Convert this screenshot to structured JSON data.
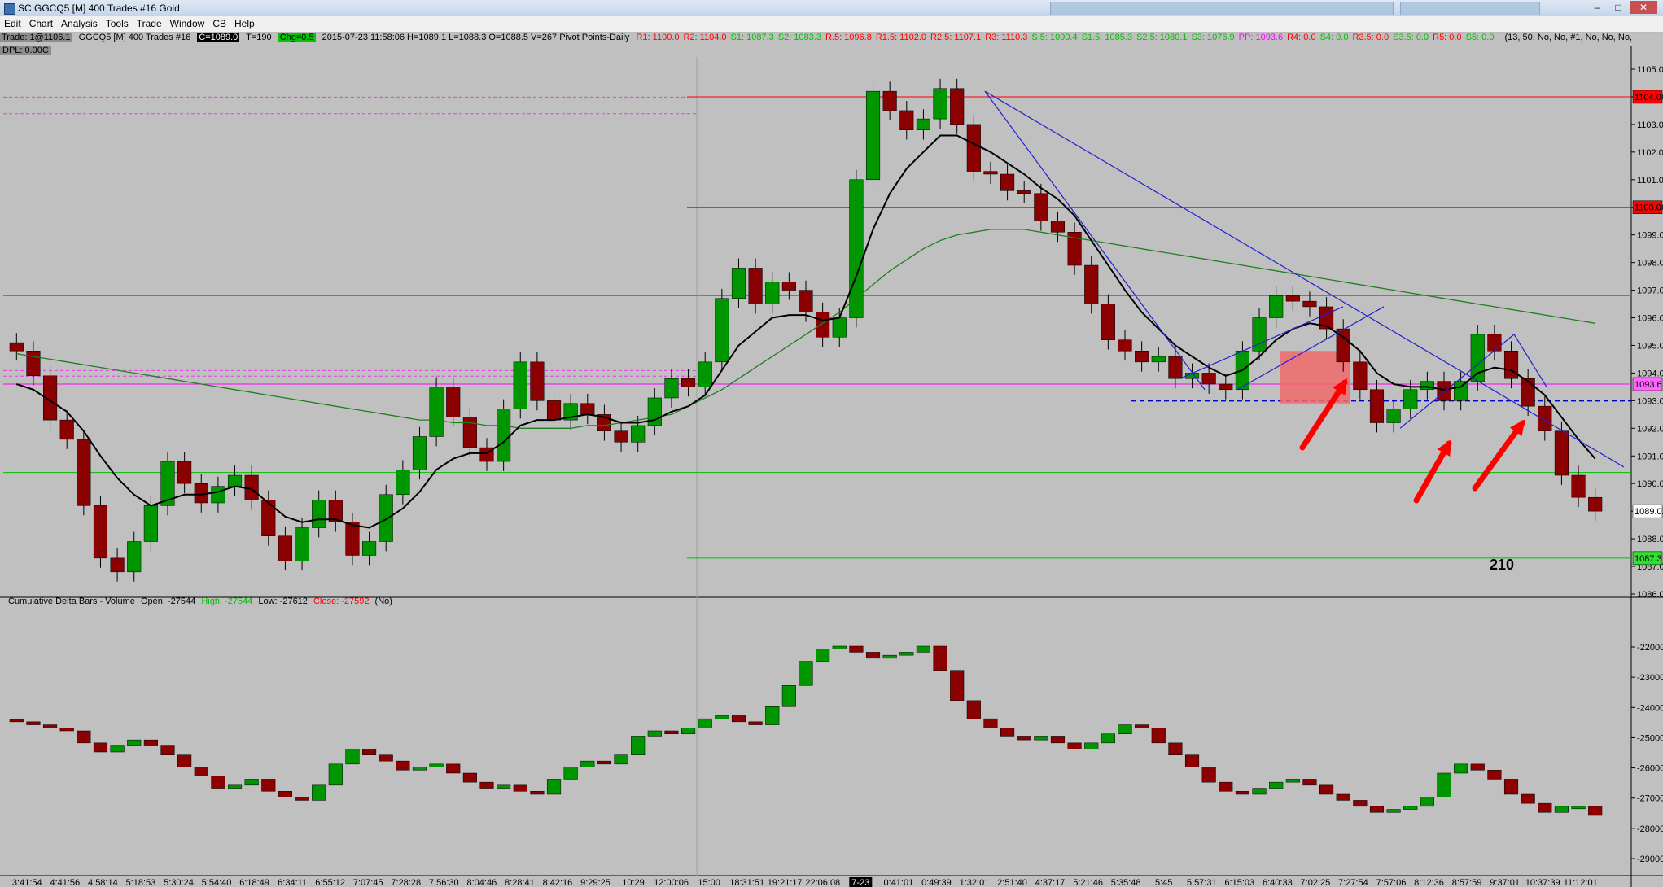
{
  "window": {
    "title": "SC GGCQ5 [M]  400 Trades  #16  Gold",
    "controls": [
      "–",
      "□",
      "✕"
    ]
  },
  "menu": [
    "Edit",
    "Chart",
    "Analysis",
    "Tools",
    "Trade",
    "Window",
    "CB",
    "Help"
  ],
  "status": {
    "trade": "Trade: 1@1106.1",
    "symbol": "GGCQ5 [M]  400 Trades  #16",
    "close": "C=1089.0",
    "ticks": "T=190",
    "change": "Chg=0.5",
    "ohlc": "2015-07-23 11:58:06 H=1089.1 L=1088.3 O=1088.5 V=267 Pivot Points-Daily",
    "pivots": [
      {
        "text": "R1: 1100.0",
        "color": "#ff0000"
      },
      {
        "text": "R2: 1104.0",
        "color": "#ff0000"
      },
      {
        "text": "S1: 1087.3",
        "color": "#00c000"
      },
      {
        "text": "S2: 1083.3",
        "color": "#00c000"
      },
      {
        "text": "R.5: 1096.8",
        "color": "#ff0000"
      },
      {
        "text": "R1.5: 1102.0",
        "color": "#ff0000"
      },
      {
        "text": "R2.5: 1107.1",
        "color": "#ff0000"
      },
      {
        "text": "R3: 1110.3",
        "color": "#ff0000"
      },
      {
        "text": "S.5: 1090.4",
        "color": "#00c000"
      },
      {
        "text": "S1.5: 1085.3",
        "color": "#00c000"
      },
      {
        "text": "S2.5: 1080.1",
        "color": "#00c000"
      },
      {
        "text": "S3: 1076.9",
        "color": "#00c000"
      },
      {
        "text": "PP: 1093.6",
        "color": "#ff00ff"
      },
      {
        "text": "R4: 0.0",
        "color": "#ff0000"
      },
      {
        "text": "S4: 0.0",
        "color": "#00c000"
      },
      {
        "text": "R3.5: 0.0",
        "color": "#ff0000"
      },
      {
        "text": "S3.5: 0.0",
        "color": "#00c000"
      },
      {
        "text": "R5: 0.0",
        "color": "#ff0000"
      },
      {
        "text": "S5: 0.0",
        "color": "#00c000"
      }
    ],
    "params": "(13, 50, No, No, #1, No, No, No,",
    "dpl": "DPL: 0.00C"
  },
  "lower_title": {
    "name": "Cumulative Delta Bars - Volume",
    "open": "Open: -27544",
    "high": "High: -27544",
    "low": "Low: -27612",
    "close": "Close: -27592",
    "flag": "(No)"
  },
  "annotation": "210",
  "colors": {
    "up": "#009600",
    "down": "#8b0000",
    "ma_fast": "#000000",
    "ma_slow": "#208020",
    "trend": "#2020d0",
    "arrow": "#ff0000",
    "zone": "#f06a6a",
    "resistance": "#ff0000",
    "support": "#00c000",
    "pivot": "#ff00ff"
  },
  "chart_data": [
    {
      "type": "line",
      "title": "",
      "x_ticks": [
        "3:41:54",
        "4:41:56",
        "4:58:14",
        "5:18:53",
        "5:30:24",
        "5:54:40",
        "6:18:49",
        "6:34:11",
        "6:55:12",
        "7:07:45",
        "7:28:28",
        "7:56:30",
        "8:04:46",
        "8:28:41",
        "8:42:16",
        "9:29:25",
        "10:29",
        "12:00:06",
        "15:00",
        "18:31:51",
        "19:21:17",
        "22:06:08",
        "7-23",
        "0:41:01",
        "0:49:39",
        "1:32:01",
        "2:51:40",
        "4:37:17",
        "5:21:46",
        "5:35:48",
        "5:45",
        "5:57:31",
        "6:15:03",
        "6:40:33",
        "7:02:25",
        "7:27:54",
        "7:57:06",
        "8:12:36",
        "8:57:59",
        "9:37:01",
        "10:37:39",
        "11:12:01"
      ],
      "y_ticks": [
        "1105.0",
        "1104.0",
        "1103.0",
        "1102.0",
        "1101.0",
        "1100.0",
        "1099.0",
        "1098.0",
        "1097.0",
        "1096.0",
        "1095.0",
        "1094.0",
        "1093.0",
        "1092.0",
        "1091.0",
        "1090.0",
        "1089.0",
        "1088.0",
        "1087.0",
        "1086.0"
      ],
      "ylim": [
        1086,
        1105.6
      ],
      "price_markers": [
        "1104.0",
        "1100.0",
        "1093.6",
        "1089.0",
        "1087.3"
      ],
      "close": [
        1094.8,
        1093.9,
        1092.3,
        1091.6,
        1089.2,
        1087.3,
        1086.8,
        1087.9,
        1089.2,
        1090.8,
        1090.0,
        1089.3,
        1089.9,
        1090.3,
        1089.4,
        1088.1,
        1087.2,
        1088.4,
        1089.4,
        1088.6,
        1087.4,
        1087.9,
        1089.6,
        1090.5,
        1091.7,
        1093.5,
        1092.4,
        1091.3,
        1090.8,
        1092.7,
        1094.4,
        1093.0,
        1092.3,
        1092.9,
        1092.5,
        1091.9,
        1091.5,
        1092.1,
        1093.1,
        1093.8,
        1093.5,
        1094.4,
        1096.7,
        1097.8,
        1096.5,
        1097.3,
        1097.0,
        1096.2,
        1095.3,
        1096.0,
        1101.0,
        1104.2,
        1103.5,
        1102.8,
        1103.2,
        1104.3,
        1103.0,
        1101.3,
        1101.2,
        1100.6,
        1100.5,
        1099.5,
        1099.1,
        1097.9,
        1096.5,
        1095.2,
        1094.8,
        1094.4,
        1094.6,
        1093.8,
        1094.0,
        1093.6,
        1093.4,
        1094.8,
        1096.0,
        1096.8,
        1096.6,
        1096.4,
        1095.6,
        1094.4,
        1093.4,
        1092.2,
        1092.7,
        1093.4,
        1093.7,
        1093.0,
        1093.7,
        1095.4,
        1094.8,
        1093.8,
        1092.8,
        1091.9,
        1090.3,
        1089.5,
        1089.0
      ],
      "ma_fast": [
        1093.6,
        1093.4,
        1093.0,
        1092.6,
        1091.9,
        1091.0,
        1090.2,
        1089.6,
        1089.2,
        1089.4,
        1089.6,
        1089.6,
        1089.7,
        1089.9,
        1089.8,
        1089.3,
        1088.8,
        1088.6,
        1088.7,
        1088.7,
        1088.5,
        1088.4,
        1088.7,
        1089.1,
        1089.7,
        1090.5,
        1090.9,
        1091.1,
        1091.1,
        1091.5,
        1092.1,
        1092.3,
        1092.3,
        1092.4,
        1092.5,
        1092.4,
        1092.2,
        1092.2,
        1092.3,
        1092.6,
        1092.8,
        1093.2,
        1094.1,
        1095.0,
        1095.5,
        1096.0,
        1096.1,
        1096.1,
        1095.9,
        1096.0,
        1097.5,
        1099.2,
        1100.5,
        1101.4,
        1102.0,
        1102.6,
        1102.6,
        1102.3,
        1102.0,
        1101.6,
        1101.2,
        1100.7,
        1100.3,
        1099.7,
        1098.8,
        1097.9,
        1097.0,
        1096.2,
        1095.6,
        1095.0,
        1094.6,
        1094.2,
        1093.9,
        1094.1,
        1094.6,
        1095.2,
        1095.6,
        1095.8,
        1095.7,
        1095.3,
        1094.8,
        1094.0,
        1093.6,
        1093.5,
        1093.5,
        1093.4,
        1093.5,
        1094.0,
        1094.2,
        1094.1,
        1093.7,
        1093.2,
        1092.4,
        1091.6,
        1090.9
      ],
      "ma_slow": [
        1094.7,
        1094.6,
        1094.5,
        1094.4,
        1094.3,
        1094.2,
        1094.1,
        1094.0,
        1093.9,
        1093.8,
        1093.7,
        1093.6,
        1093.5,
        1093.4,
        1093.3,
        1093.2,
        1093.1,
        1093.0,
        1092.9,
        1092.8,
        1092.7,
        1092.6,
        1092.5,
        1092.4,
        1092.3,
        1092.3,
        1092.2,
        1092.2,
        1092.1,
        1092.1,
        1092.0,
        1092.0,
        1092.0,
        1092.0,
        1092.1,
        1092.1,
        1092.2,
        1092.3,
        1092.4,
        1092.5,
        1092.8,
        1093.1,
        1093.4,
        1093.8,
        1094.2,
        1094.6,
        1095.0,
        1095.4,
        1095.8,
        1096.2,
        1096.7,
        1097.2,
        1097.7,
        1098.1,
        1098.5,
        1098.8,
        1099.0,
        1099.1,
        1099.2,
        1099.2,
        1099.2,
        1099.1,
        1099.0,
        1098.9,
        1098.8,
        1098.7,
        1098.6,
        1098.5,
        1098.4,
        1098.3,
        1098.2,
        1098.1,
        1098.0,
        1097.9,
        1097.8,
        1097.7,
        1097.6,
        1097.5,
        1097.4,
        1097.3,
        1097.2,
        1097.1,
        1097.0,
        1096.9,
        1096.8,
        1096.7,
        1096.6,
        1096.5,
        1096.4,
        1096.3,
        1096.2,
        1096.1,
        1096.0,
        1095.9,
        1095.8
      ],
      "pivot_lines": [
        {
          "label": "R2",
          "value": 1104.0,
          "from": 0.42
        },
        {
          "label": "R1",
          "value": 1100.0,
          "from": 0.42
        },
        {
          "label": "R.5",
          "value": 1096.8,
          "from": 0.0
        },
        {
          "label": "PP",
          "value": 1093.6,
          "from": 0.0
        },
        {
          "label": "S.5",
          "value": 1090.4,
          "from": 0.0
        },
        {
          "label": "S1",
          "value": 1087.3,
          "from": 0.42
        }
      ],
      "support_level": 1093.0
    },
    {
      "type": "line",
      "title": "Cumulative Delta Bars - Volume",
      "y_ticks": [
        "-22000",
        "-23000",
        "-24000",
        "-25000",
        "-26000",
        "-27000",
        "-28000",
        "-29000"
      ],
      "ylim": [
        -29200,
        -21300
      ],
      "values": [
        -24500,
        -24600,
        -24700,
        -24800,
        -25200,
        -25500,
        -25300,
        -25100,
        -25300,
        -25600,
        -26000,
        -26300,
        -26700,
        -26600,
        -26400,
        -26800,
        -27000,
        -27100,
        -26600,
        -25900,
        -25400,
        -25600,
        -25800,
        -26100,
        -26000,
        -25900,
        -26200,
        -26500,
        -26700,
        -26600,
        -26800,
        -26900,
        -26400,
        -26000,
        -25800,
        -25900,
        -25600,
        -25000,
        -24800,
        -24900,
        -24700,
        -24400,
        -24300,
        -24500,
        -24600,
        -24000,
        -23300,
        -22500,
        -22100,
        -22000,
        -22200,
        -22400,
        -22300,
        -22200,
        -22000,
        -22800,
        -23800,
        -24400,
        -24700,
        -25000,
        -25100,
        -25000,
        -25200,
        -25400,
        -25200,
        -24900,
        -24600,
        -24700,
        -25200,
        -25600,
        -26000,
        -26500,
        -26800,
        -26900,
        -26700,
        -26500,
        -26400,
        -26600,
        -26900,
        -27100,
        -27300,
        -27500,
        -27400,
        -27300,
        -27000,
        -26200,
        -25900,
        -26100,
        -26400,
        -26900,
        -27200,
        -27500,
        -27300,
        -27300,
        -27600
      ],
      "x_ticks": [
        "3:41:54",
        "4:41:56",
        "4:58:14",
        "5:18:53",
        "5:30:24",
        "5:54:40",
        "6:18:49",
        "6:34:11",
        "6:55:12",
        "7:07:45",
        "7:28:28",
        "7:56:30",
        "8:04:46",
        "8:28:41",
        "8:42:16",
        "9:29:25",
        "10:29",
        "12:00:06",
        "15:00",
        "18:31:51",
        "19:21:17",
        "22:06:08",
        "7-23",
        "0:41:01",
        "0:49:39",
        "1:32:01",
        "2:51:40",
        "4:37:17",
        "5:21:46",
        "5:35:48",
        "5:45",
        "5:57:31",
        "6:15:03",
        "6:40:33",
        "7:02:25",
        "7:27:54",
        "7:57:06",
        "8:12:36",
        "8:57:59",
        "9:37:01",
        "10:37:39",
        "11:12:01"
      ]
    }
  ]
}
